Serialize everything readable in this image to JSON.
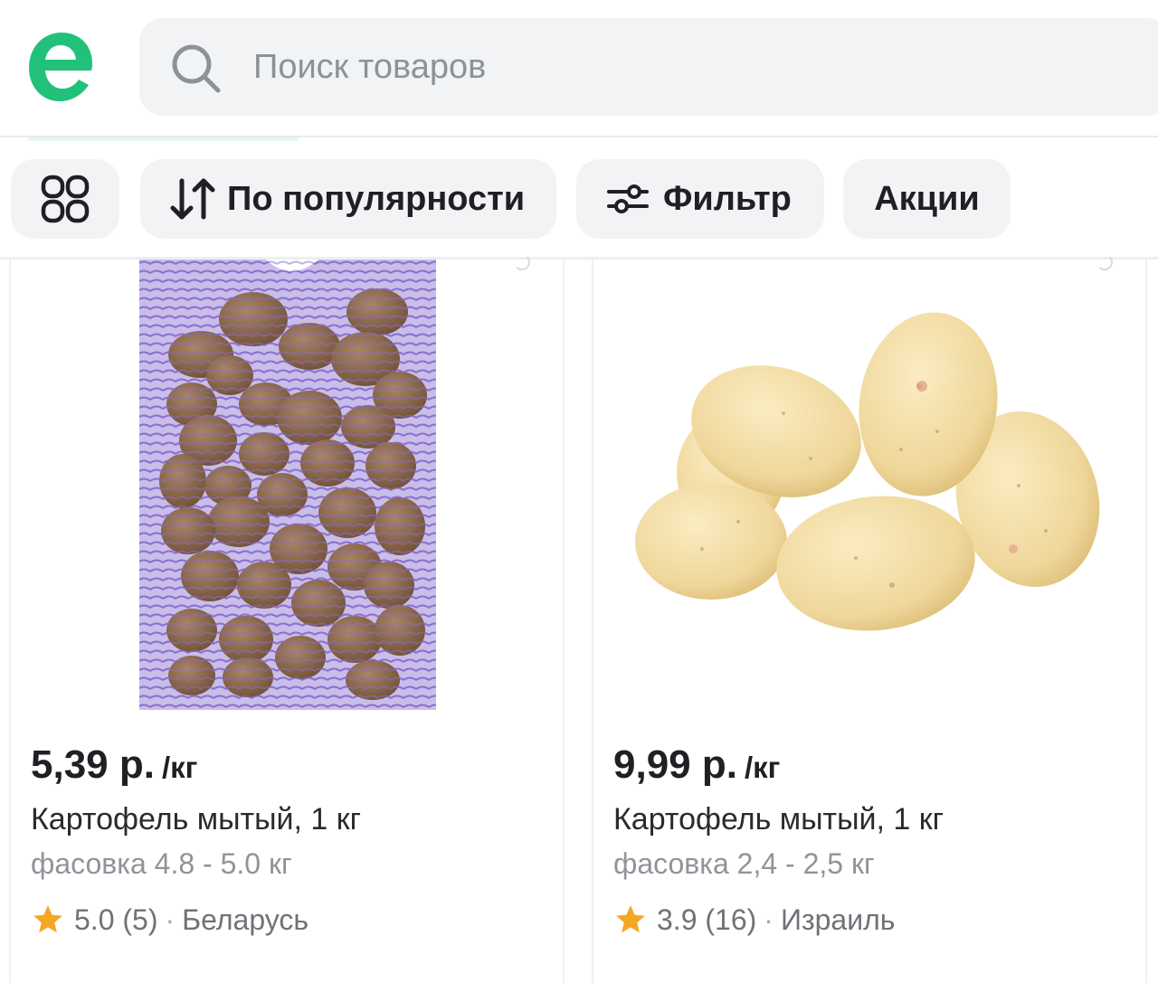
{
  "header": {
    "search_placeholder": "Поиск товаров",
    "logo_letter": "e",
    "brand_color": "#21c17a"
  },
  "toolbar": {
    "sort_label": "По популярности",
    "filter_label": "Фильтр",
    "promo_label": "Акции"
  },
  "products": [
    {
      "price": "5,39 р.",
      "unit": "/кг",
      "title": "Картофель мытый, 1 кг",
      "pack": "фасовка 4.8 - 5.0 кг",
      "rating": "5.0",
      "reviews": "(5)",
      "country": "Беларусь",
      "image": "potato-net-bag"
    },
    {
      "price": "9,99 р.",
      "unit": "/кг",
      "title": "Картофель мытый, 1 кг",
      "pack": "фасовка 2,4 - 2,5 кг",
      "rating": "3.9",
      "reviews": "(16)",
      "country": "Израиль",
      "image": "washed-potatoes"
    }
  ],
  "separator": "·",
  "star_color": "#f5a623"
}
